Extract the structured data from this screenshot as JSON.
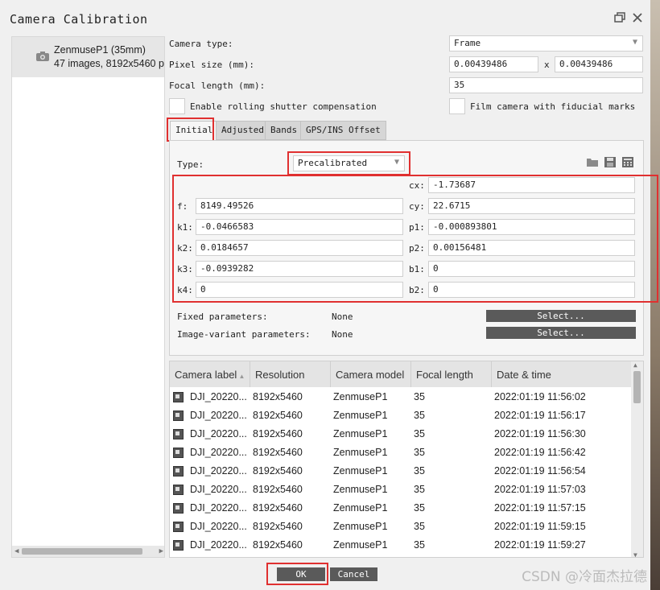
{
  "window": {
    "title": "Camera Calibration"
  },
  "camera_list": [
    {
      "name": "ZenmuseP1 (35mm)",
      "info": "47 images, 8192x5460 p"
    }
  ],
  "camera_type": {
    "label": "Camera type:",
    "value": "Frame"
  },
  "pixel_size": {
    "label": "Pixel size (mm):",
    "x": "0.00439486",
    "sep": "x",
    "y": "0.00439486"
  },
  "focal_length": {
    "label": "Focal length (mm):",
    "value": "35"
  },
  "rolling_shutter": {
    "label": "Enable rolling shutter compensation",
    "checked": false
  },
  "film_camera": {
    "label": "Film camera with fiducial marks",
    "checked": false
  },
  "tabs": [
    "Initial",
    "Adjusted",
    "Bands",
    "GPS/INS Offset"
  ],
  "active_tab": "Initial",
  "calib": {
    "type_label": "Type:",
    "type_value": "Precalibrated",
    "params": {
      "cx": {
        "label": "cx:",
        "value": "-1.73687"
      },
      "f": {
        "label": "f:",
        "value": "8149.49526"
      },
      "cy": {
        "label": "cy:",
        "value": "22.6715"
      },
      "k1": {
        "label": "k1:",
        "value": "-0.0466583"
      },
      "p1": {
        "label": "p1:",
        "value": "-0.000893801"
      },
      "k2": {
        "label": "k2:",
        "value": "0.0184657"
      },
      "p2": {
        "label": "p2:",
        "value": "0.00156481"
      },
      "k3": {
        "label": "k3:",
        "value": "-0.0939282"
      },
      "b1": {
        "label": "b1:",
        "value": "0"
      },
      "k4": {
        "label": "k4:",
        "value": "0"
      },
      "b2": {
        "label": "b2:",
        "value": "0"
      }
    },
    "fixed_label": "Fixed parameters:",
    "fixed_value": "None",
    "variant_label": "Image-variant parameters:",
    "variant_value": "None",
    "select_label": "Select..."
  },
  "images_table": {
    "columns": [
      "Camera label",
      "Resolution",
      "Camera model",
      "Focal length",
      "Date & time"
    ],
    "rows": [
      [
        "DJI_20220...",
        "8192x5460",
        "ZenmuseP1",
        "35",
        "2022:01:19 11:56:02"
      ],
      [
        "DJI_20220...",
        "8192x5460",
        "ZenmuseP1",
        "35",
        "2022:01:19 11:56:17"
      ],
      [
        "DJI_20220...",
        "8192x5460",
        "ZenmuseP1",
        "35",
        "2022:01:19 11:56:30"
      ],
      [
        "DJI_20220...",
        "8192x5460",
        "ZenmuseP1",
        "35",
        "2022:01:19 11:56:42"
      ],
      [
        "DJI_20220...",
        "8192x5460",
        "ZenmuseP1",
        "35",
        "2022:01:19 11:56:54"
      ],
      [
        "DJI_20220...",
        "8192x5460",
        "ZenmuseP1",
        "35",
        "2022:01:19 11:57:03"
      ],
      [
        "DJI_20220...",
        "8192x5460",
        "ZenmuseP1",
        "35",
        "2022:01:19 11:57:15"
      ],
      [
        "DJI_20220...",
        "8192x5460",
        "ZenmuseP1",
        "35",
        "2022:01:19 11:59:15"
      ],
      [
        "DJI_20220...",
        "8192x5460",
        "ZenmuseP1",
        "35",
        "2022:01:19 11:59:27"
      ]
    ]
  },
  "buttons": {
    "ok": "OK",
    "cancel": "Cancel"
  },
  "watermark": "CSDN @冷面杰拉德",
  "colors": {
    "highlight": "#e03030",
    "button": "#5a5a5a"
  }
}
